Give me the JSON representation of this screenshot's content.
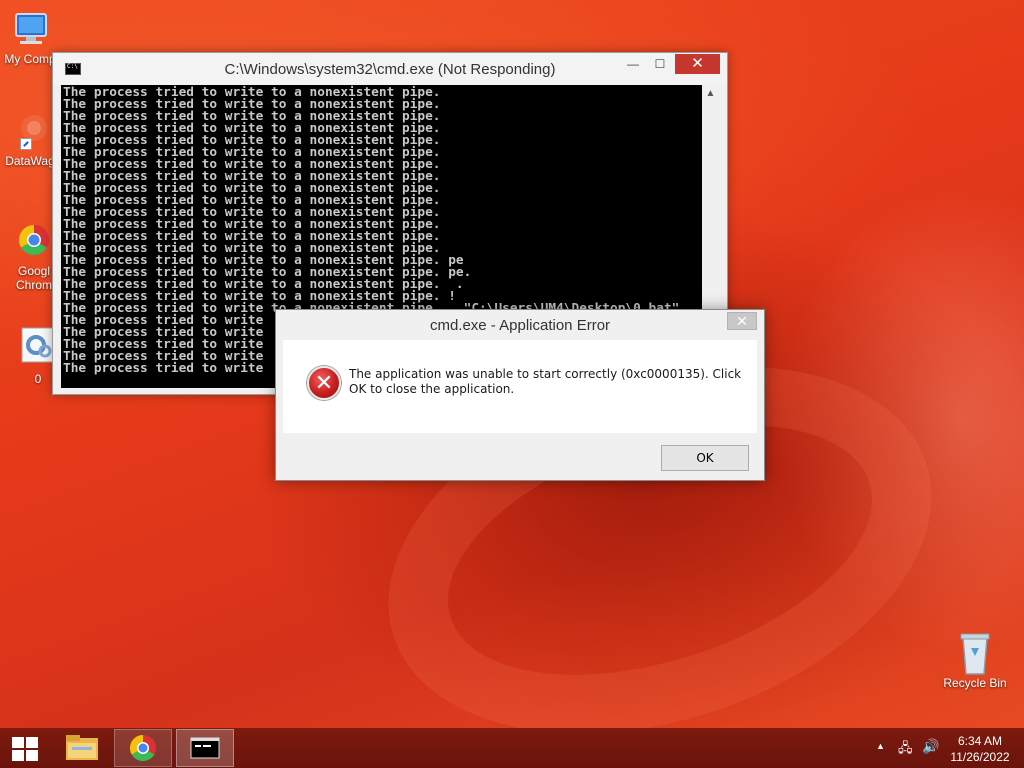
{
  "desktop": {
    "icons": [
      {
        "label": "My Comp",
        "icon": "computer-icon"
      },
      {
        "label": "DataWag",
        "icon": "datawag-shortcut-icon"
      },
      {
        "label": "Googl\nChrom",
        "icon": "chrome-icon"
      },
      {
        "label": "0",
        "icon": "batch-file-icon"
      },
      {
        "label": "Recycle Bin",
        "icon": "recycle-bin-icon"
      }
    ]
  },
  "cmd_window": {
    "title": "C:\\Windows\\system32\\cmd.exe (Not Responding)",
    "controls": {
      "minimize": "—",
      "maximize": "☐",
      "close": "✕"
    },
    "lines": [
      "The process tried to write to a nonexistent pipe.",
      "The process tried to write to a nonexistent pipe.",
      "The process tried to write to a nonexistent pipe.",
      "The process tried to write to a nonexistent pipe.",
      "The process tried to write to a nonexistent pipe.",
      "The process tried to write to a nonexistent pipe.",
      "The process tried to write to a nonexistent pipe.",
      "The process tried to write to a nonexistent pipe.",
      "The process tried to write to a nonexistent pipe.",
      "The process tried to write to a nonexistent pipe.",
      "The process tried to write to a nonexistent pipe.",
      "The process tried to write to a nonexistent pipe.",
      "The process tried to write to a nonexistent pipe.",
      "The process tried to write to a nonexistent pipe.",
      "The process tried to write to a nonexistent pipe. pe",
      "The process tried to write to a nonexistent pipe. pe.",
      "The process tried to write to a nonexistent pipe.  .",
      "The process tried to write to a nonexistent pipe. !",
      "The process tried to write to a nonexistent pipe.   \"C:\\Users\\UM4\\Desktop\\0.bat\"",
      "The process tried to write",
      "The process tried to write",
      "The process tried to write",
      "The process tried to write",
      "The process tried to write"
    ]
  },
  "error_dialog": {
    "title": "cmd.exe - Application Error",
    "close": "✕",
    "message": "The application was unable to start correctly (0xc0000135). Click OK to close the application.",
    "icon": "error-icon",
    "ok_label": "OK"
  },
  "taskbar": {
    "items": [
      {
        "name": "start",
        "icon": "windows-logo-icon"
      },
      {
        "name": "file-explorer",
        "icon": "folder-icon"
      },
      {
        "name": "google-chrome",
        "icon": "chrome-icon"
      },
      {
        "name": "command-prompt",
        "icon": "cmd-icon"
      }
    ],
    "tray": {
      "show_hidden": "▲",
      "network": "🖧",
      "volume": "🔊"
    },
    "clock": {
      "time": "6:34 AM",
      "date": "11/26/2022"
    }
  },
  "colors": {
    "wallpaper": "#e8421a",
    "taskbar": "#731710",
    "close_red": "#c7372f",
    "console_bg": "#000000",
    "console_fg": "#c8c8c8"
  }
}
